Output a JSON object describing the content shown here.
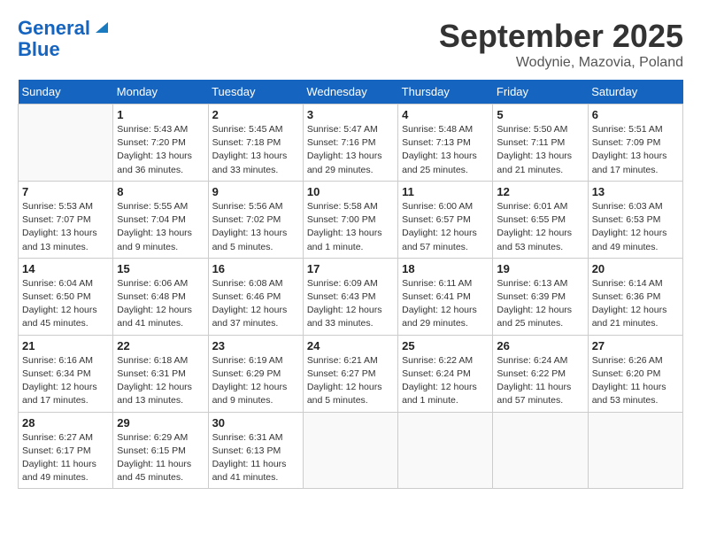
{
  "header": {
    "logo_line1": "General",
    "logo_line2": "Blue",
    "month": "September 2025",
    "location": "Wodynie, Mazovia, Poland"
  },
  "weekdays": [
    "Sunday",
    "Monday",
    "Tuesday",
    "Wednesday",
    "Thursday",
    "Friday",
    "Saturday"
  ],
  "weeks": [
    [
      {
        "day": "",
        "info": ""
      },
      {
        "day": "1",
        "info": "Sunrise: 5:43 AM\nSunset: 7:20 PM\nDaylight: 13 hours\nand 36 minutes."
      },
      {
        "day": "2",
        "info": "Sunrise: 5:45 AM\nSunset: 7:18 PM\nDaylight: 13 hours\nand 33 minutes."
      },
      {
        "day": "3",
        "info": "Sunrise: 5:47 AM\nSunset: 7:16 PM\nDaylight: 13 hours\nand 29 minutes."
      },
      {
        "day": "4",
        "info": "Sunrise: 5:48 AM\nSunset: 7:13 PM\nDaylight: 13 hours\nand 25 minutes."
      },
      {
        "day": "5",
        "info": "Sunrise: 5:50 AM\nSunset: 7:11 PM\nDaylight: 13 hours\nand 21 minutes."
      },
      {
        "day": "6",
        "info": "Sunrise: 5:51 AM\nSunset: 7:09 PM\nDaylight: 13 hours\nand 17 minutes."
      }
    ],
    [
      {
        "day": "7",
        "info": "Sunrise: 5:53 AM\nSunset: 7:07 PM\nDaylight: 13 hours\nand 13 minutes."
      },
      {
        "day": "8",
        "info": "Sunrise: 5:55 AM\nSunset: 7:04 PM\nDaylight: 13 hours\nand 9 minutes."
      },
      {
        "day": "9",
        "info": "Sunrise: 5:56 AM\nSunset: 7:02 PM\nDaylight: 13 hours\nand 5 minutes."
      },
      {
        "day": "10",
        "info": "Sunrise: 5:58 AM\nSunset: 7:00 PM\nDaylight: 13 hours\nand 1 minute."
      },
      {
        "day": "11",
        "info": "Sunrise: 6:00 AM\nSunset: 6:57 PM\nDaylight: 12 hours\nand 57 minutes."
      },
      {
        "day": "12",
        "info": "Sunrise: 6:01 AM\nSunset: 6:55 PM\nDaylight: 12 hours\nand 53 minutes."
      },
      {
        "day": "13",
        "info": "Sunrise: 6:03 AM\nSunset: 6:53 PM\nDaylight: 12 hours\nand 49 minutes."
      }
    ],
    [
      {
        "day": "14",
        "info": "Sunrise: 6:04 AM\nSunset: 6:50 PM\nDaylight: 12 hours\nand 45 minutes."
      },
      {
        "day": "15",
        "info": "Sunrise: 6:06 AM\nSunset: 6:48 PM\nDaylight: 12 hours\nand 41 minutes."
      },
      {
        "day": "16",
        "info": "Sunrise: 6:08 AM\nSunset: 6:46 PM\nDaylight: 12 hours\nand 37 minutes."
      },
      {
        "day": "17",
        "info": "Sunrise: 6:09 AM\nSunset: 6:43 PM\nDaylight: 12 hours\nand 33 minutes."
      },
      {
        "day": "18",
        "info": "Sunrise: 6:11 AM\nSunset: 6:41 PM\nDaylight: 12 hours\nand 29 minutes."
      },
      {
        "day": "19",
        "info": "Sunrise: 6:13 AM\nSunset: 6:39 PM\nDaylight: 12 hours\nand 25 minutes."
      },
      {
        "day": "20",
        "info": "Sunrise: 6:14 AM\nSunset: 6:36 PM\nDaylight: 12 hours\nand 21 minutes."
      }
    ],
    [
      {
        "day": "21",
        "info": "Sunrise: 6:16 AM\nSunset: 6:34 PM\nDaylight: 12 hours\nand 17 minutes."
      },
      {
        "day": "22",
        "info": "Sunrise: 6:18 AM\nSunset: 6:31 PM\nDaylight: 12 hours\nand 13 minutes."
      },
      {
        "day": "23",
        "info": "Sunrise: 6:19 AM\nSunset: 6:29 PM\nDaylight: 12 hours\nand 9 minutes."
      },
      {
        "day": "24",
        "info": "Sunrise: 6:21 AM\nSunset: 6:27 PM\nDaylight: 12 hours\nand 5 minutes."
      },
      {
        "day": "25",
        "info": "Sunrise: 6:22 AM\nSunset: 6:24 PM\nDaylight: 12 hours\nand 1 minute."
      },
      {
        "day": "26",
        "info": "Sunrise: 6:24 AM\nSunset: 6:22 PM\nDaylight: 11 hours\nand 57 minutes."
      },
      {
        "day": "27",
        "info": "Sunrise: 6:26 AM\nSunset: 6:20 PM\nDaylight: 11 hours\nand 53 minutes."
      }
    ],
    [
      {
        "day": "28",
        "info": "Sunrise: 6:27 AM\nSunset: 6:17 PM\nDaylight: 11 hours\nand 49 minutes."
      },
      {
        "day": "29",
        "info": "Sunrise: 6:29 AM\nSunset: 6:15 PM\nDaylight: 11 hours\nand 45 minutes."
      },
      {
        "day": "30",
        "info": "Sunrise: 6:31 AM\nSunset: 6:13 PM\nDaylight: 11 hours\nand 41 minutes."
      },
      {
        "day": "",
        "info": ""
      },
      {
        "day": "",
        "info": ""
      },
      {
        "day": "",
        "info": ""
      },
      {
        "day": "",
        "info": ""
      }
    ]
  ]
}
